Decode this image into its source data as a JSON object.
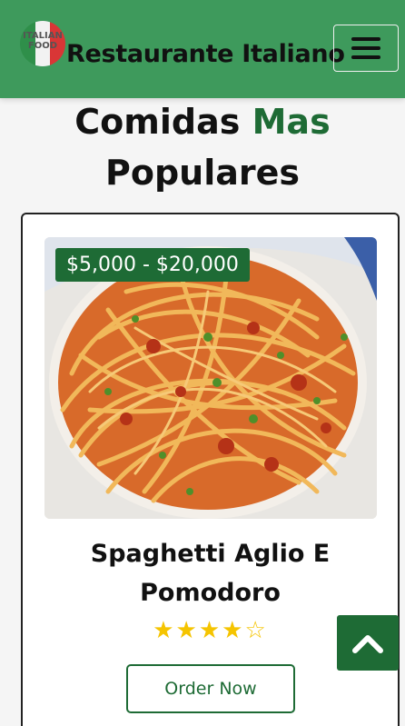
{
  "navbar": {
    "logo_text": "ITALIAN FOOD",
    "brand": "Restaurante Italiano",
    "menu_icon": "hamburger-menu-icon"
  },
  "section": {
    "title_part1": "Comidas ",
    "title_accent": "Mas",
    "title_part2": "Populares"
  },
  "card": {
    "price": "$5,000 - $20,000",
    "name": "Spaghetti Aglio E Pomodoro",
    "rating": 4,
    "rating_max": 5,
    "star_full": "★",
    "star_empty": "☆",
    "order_label": "Order Now",
    "image_icon": "spaghetti-photo"
  },
  "scroll_top_icon": "chevron-up-icon",
  "colors": {
    "navbar": "#3e9a5c",
    "accent": "#1e6b35",
    "star": "#f5c400"
  }
}
